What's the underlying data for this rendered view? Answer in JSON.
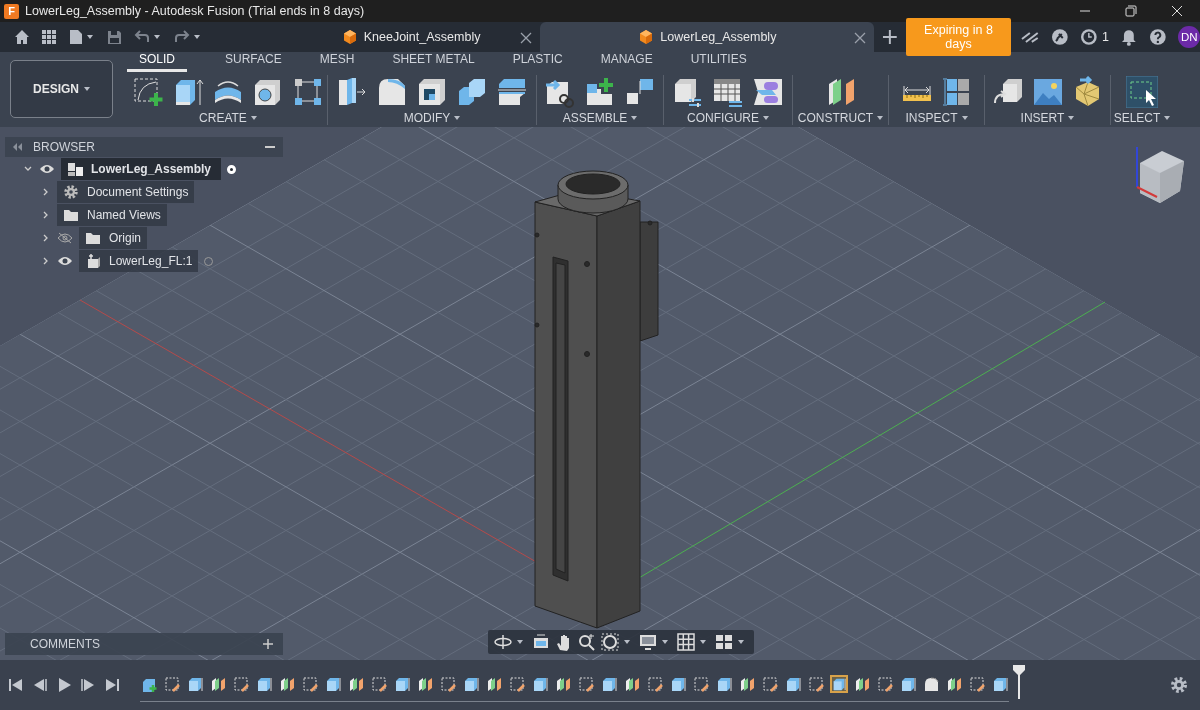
{
  "window": {
    "logo": "F",
    "title": "LowerLeg_Assembly - Autodesk Fusion (Trial ends in 8 days)"
  },
  "documents": [
    {
      "label": "KneeJoint_Assembly",
      "selected": false
    },
    {
      "label": "LowerLeg_Assembly",
      "selected": true
    }
  ],
  "header": {
    "badge": "Expiring in 8 days",
    "job_count": "1",
    "avatar": "DN"
  },
  "ribbon": {
    "workspace": "DESIGN",
    "tabs": [
      {
        "label": "SOLID",
        "selected": true
      },
      {
        "label": "SURFACE",
        "selected": false
      },
      {
        "label": "MESH",
        "selected": false
      },
      {
        "label": "SHEET METAL",
        "selected": false
      },
      {
        "label": "PLASTIC",
        "selected": false
      },
      {
        "label": "MANAGE",
        "selected": false
      },
      {
        "label": "UTILITIES",
        "selected": false
      }
    ],
    "groups": [
      "CREATE",
      "MODIFY",
      "ASSEMBLE",
      "CONFIGURE",
      "CONSTRUCT",
      "INSPECT",
      "INSERT",
      "SELECT"
    ]
  },
  "browser": {
    "title": "BROWSER",
    "tree": [
      {
        "label": "LowerLeg_Assembly",
        "kind": "assembly",
        "expanded": true,
        "visible": true,
        "active": true,
        "children": [
          {
            "label": "Document Settings",
            "kind": "settings",
            "expanded": false
          },
          {
            "label": "Named Views",
            "kind": "folder",
            "expanded": false
          },
          {
            "label": "Origin",
            "kind": "folder",
            "expanded": false,
            "visible": false
          },
          {
            "label": "LowerLeg_FL:1",
            "kind": "component",
            "expanded": false,
            "visible": true,
            "active": false
          }
        ]
      }
    ]
  },
  "comments": {
    "title": "COMMENTS"
  },
  "timeline": {
    "features": [
      {
        "kind": "component",
        "selected": false
      },
      {
        "kind": "sketch",
        "selected": false
      },
      {
        "kind": "extrude",
        "selected": false
      },
      {
        "kind": "plane",
        "selected": false
      },
      {
        "kind": "sketch",
        "selected": false
      },
      {
        "kind": "extrude",
        "selected": false
      },
      {
        "kind": "plane",
        "selected": false
      },
      {
        "kind": "sketch",
        "selected": false
      },
      {
        "kind": "extrude",
        "selected": false
      },
      {
        "kind": "plane",
        "selected": false
      },
      {
        "kind": "sketch",
        "selected": false
      },
      {
        "kind": "extrude",
        "selected": false
      },
      {
        "kind": "plane",
        "selected": false
      },
      {
        "kind": "sketch",
        "selected": false
      },
      {
        "kind": "extrude",
        "selected": false
      },
      {
        "kind": "plane",
        "selected": false
      },
      {
        "kind": "sketch",
        "selected": false
      },
      {
        "kind": "extrude",
        "selected": false
      },
      {
        "kind": "plane",
        "selected": false
      },
      {
        "kind": "sketch",
        "selected": false
      },
      {
        "kind": "extrude",
        "selected": false
      },
      {
        "kind": "plane",
        "selected": false
      },
      {
        "kind": "sketch",
        "selected": false
      },
      {
        "kind": "extrude",
        "selected": false
      },
      {
        "kind": "sketch",
        "selected": false
      },
      {
        "kind": "extrude",
        "selected": false
      },
      {
        "kind": "plane",
        "selected": false
      },
      {
        "kind": "sketch",
        "selected": false
      },
      {
        "kind": "extrude",
        "selected": false
      },
      {
        "kind": "sketch",
        "selected": false
      },
      {
        "kind": "extrude",
        "selected": true
      },
      {
        "kind": "plane",
        "selected": false
      },
      {
        "kind": "sketch",
        "selected": false
      },
      {
        "kind": "extrude",
        "selected": false
      },
      {
        "kind": "fillet",
        "selected": false
      },
      {
        "kind": "plane",
        "selected": false
      },
      {
        "kind": "sketch",
        "selected": false
      },
      {
        "kind": "extrude",
        "selected": false
      }
    ]
  }
}
